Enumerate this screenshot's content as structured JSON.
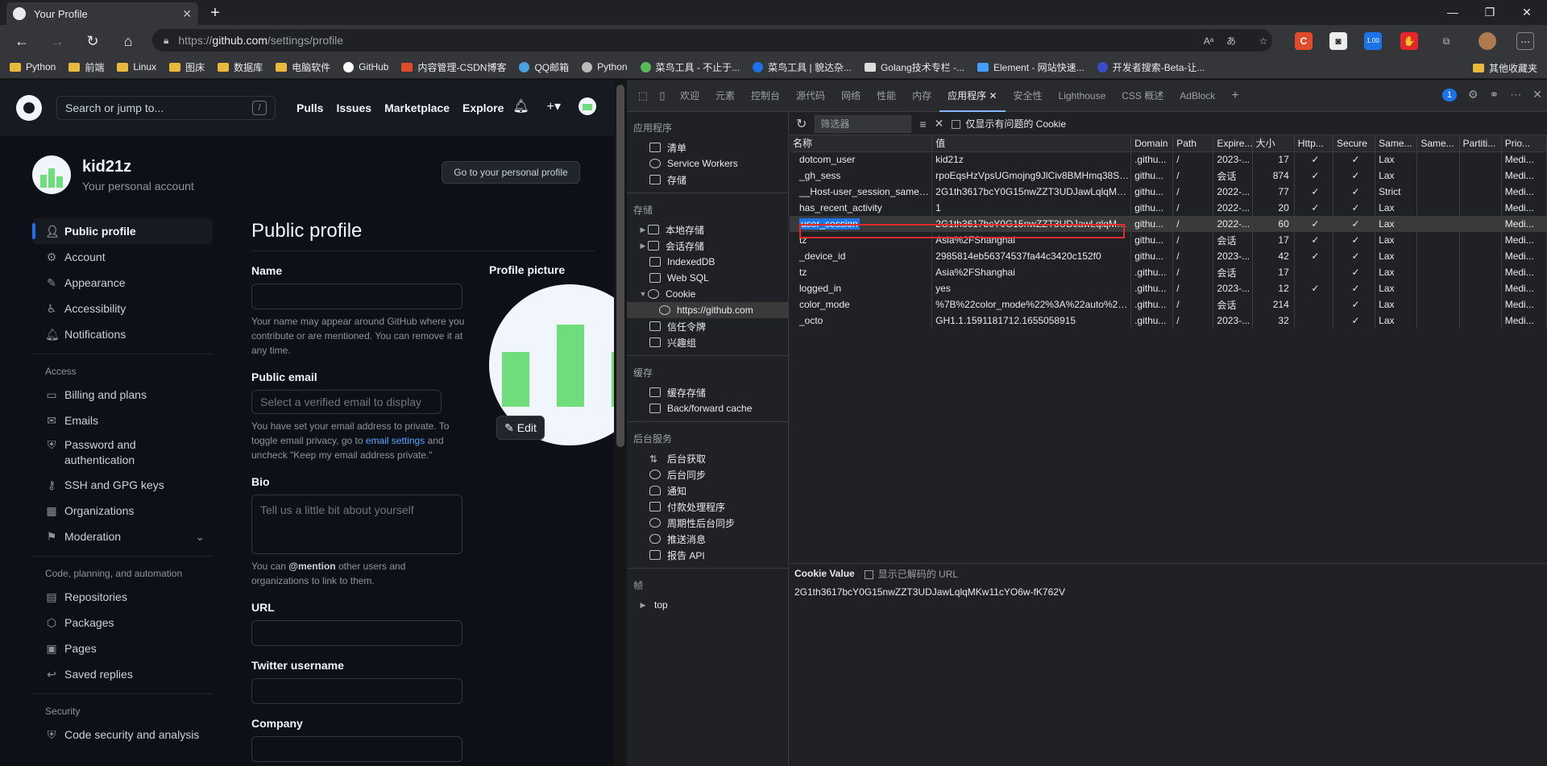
{
  "browser": {
    "tab_title": "Your Profile",
    "url_prefix": "https://",
    "url_host": "github.com",
    "url_path": "/settings/profile",
    "reader_icon": "Aᵀ",
    "zoom_badge": "1.00"
  },
  "bookmarks": [
    "Python",
    "前端",
    "Linux",
    "图床",
    "数据库",
    "电脑软件",
    "GitHub",
    "内容管理-CSDN博客",
    "QQ邮箱",
    "Python",
    "菜鸟工具 - 不止于...",
    "菜鸟工具 | 貌达杂...",
    "Golang技术专栏 -...",
    "Element - 网站快速...",
    "开发者搜索-Beta-让..."
  ],
  "bookmarks_other": "其他收藏夹",
  "github": {
    "search_placeholder": "Search or jump to...",
    "search_key": "/",
    "nav": [
      "Pulls",
      "Issues",
      "Marketplace",
      "Explore"
    ],
    "username": "kid21z",
    "account_sub": "Your personal account",
    "personal_profile_btn": "Go to your personal profile",
    "menu": {
      "public_profile": "Public profile",
      "account": "Account",
      "appearance": "Appearance",
      "accessibility": "Accessibility",
      "notifications": "Notifications",
      "access_header": "Access",
      "billing": "Billing and plans",
      "emails": "Emails",
      "password_line1": "Password and",
      "password_line2": "authentication",
      "ssh": "SSH and GPG keys",
      "organizations": "Organizations",
      "moderation": "Moderation",
      "code_header": "Code, planning, and automation",
      "repositories": "Repositories",
      "packages": "Packages",
      "pages": "Pages",
      "saved_replies": "Saved replies",
      "security_header": "Security",
      "code_security": "Code security and analysis"
    },
    "form": {
      "title": "Public profile",
      "name_label": "Name",
      "name_note": "Your name may appear around GitHub where you contribute or are mentioned. You can remove it at any time.",
      "email_label": "Public email",
      "email_placeholder": "Select a verified email to display",
      "email_note_1": "You have set your email address to private. To toggle email privacy, go to ",
      "email_note_link": "email settings",
      "email_note_2": " and uncheck \"Keep my email address private.\"",
      "bio_label": "Bio",
      "bio_placeholder": "Tell us a little bit about yourself",
      "bio_note_1": "You can ",
      "bio_note_mention": "@mention",
      "bio_note_2": " other users and organizations to link to them.",
      "url_label": "URL",
      "twitter_label": "Twitter username",
      "company_label": "Company",
      "picture_label": "Profile picture",
      "edit_btn": "Edit"
    }
  },
  "devtools": {
    "tabs": [
      "欢迎",
      "元素",
      "控制台",
      "源代码",
      "网络",
      "性能",
      "内存",
      "应用程序",
      "安全性",
      "Lighthouse",
      "CSS 概述",
      "AdBlock"
    ],
    "issues_count": "1",
    "sidebar": {
      "app_header": "应用程序",
      "manifest": "清单",
      "service_workers": "Service Workers",
      "storage": "存储",
      "storage_header": "存储",
      "local_storage": "本地存储",
      "session_storage": "会话存储",
      "indexeddb": "IndexedDB",
      "websql": "Web SQL",
      "cookie": "Cookie",
      "cookie_origin": "https://github.com",
      "trust_tokens": "信任令牌",
      "interest_groups": "兴趣组",
      "cache_header": "缓存",
      "cache_storage": "缓存存储",
      "bfcache": "Back/forward cache",
      "bg_header": "后台服务",
      "bg_fetch": "后台获取",
      "bg_sync": "后台同步",
      "notifications": "通知",
      "payment": "付款处理程序",
      "periodic_sync": "周期性后台同步",
      "push": "推送消息",
      "reporting": "报告 API",
      "frames_header": "帧",
      "top": "top"
    },
    "filter_placeholder": "筛选器",
    "only_issues": "仅显示有问题的 Cookie",
    "columns": [
      "名称",
      "值",
      "Domain",
      "Path",
      "Expire...",
      "大小",
      "Http...",
      "Secure",
      "Same...",
      "Same...",
      "Partiti...",
      "Prio..."
    ],
    "rows": [
      [
        "dotcom_user",
        "kid21z",
        ".githu...",
        "/",
        "2023-...",
        "17",
        "✓",
        "✓",
        "Lax",
        "",
        "",
        "Medi..."
      ],
      [
        "_gh_sess",
        "rpoEqsHzVpsUGmojng9JlCiv8BMHmq38SV...",
        "githu...",
        "/",
        "会话",
        "874",
        "✓",
        "✓",
        "Lax",
        "",
        "",
        "Medi..."
      ],
      [
        "__Host-user_session_same_...",
        "2G1th3617bcY0G15nwZZT3UDJawLqlqMK...",
        "githu...",
        "/",
        "2022-...",
        "77",
        "✓",
        "✓",
        "Strict",
        "",
        "",
        "Medi..."
      ],
      [
        "has_recent_activity",
        "1",
        "githu...",
        "/",
        "2022-...",
        "20",
        "✓",
        "✓",
        "Lax",
        "",
        "",
        "Medi..."
      ],
      [
        "user_session",
        "2G1th3617bcY0G15nwZZT3UDJawLqlqMK...",
        "githu...",
        "/",
        "2022-...",
        "60",
        "✓",
        "✓",
        "Lax",
        "",
        "",
        "Medi..."
      ],
      [
        "tz",
        "Asia%2FShanghai",
        "githu...",
        "/",
        "会话",
        "17",
        "✓",
        "✓",
        "Lax",
        "",
        "",
        "Medi..."
      ],
      [
        "_device_id",
        "2985814eb56374537fa44c3420c152f0",
        "githu...",
        "/",
        "2023-...",
        "42",
        "✓",
        "✓",
        "Lax",
        "",
        "",
        "Medi..."
      ],
      [
        "tz",
        "Asia%2FShanghai",
        ".githu...",
        "/",
        "会话",
        "17",
        "",
        "✓",
        "Lax",
        "",
        "",
        "Medi..."
      ],
      [
        "logged_in",
        "yes",
        ".githu...",
        "/",
        "2023-...",
        "12",
        "✓",
        "✓",
        "Lax",
        "",
        "",
        "Medi..."
      ],
      [
        "color_mode",
        "%7B%22color_mode%22%3A%22auto%22...",
        ".githu...",
        "/",
        "会话",
        "214",
        "",
        "✓",
        "Lax",
        "",
        "",
        "Medi..."
      ],
      [
        "_octo",
        "GH1.1.1591181712.1655058915",
        ".githu...",
        "/",
        "2023-...",
        "32",
        "",
        "✓",
        "Lax",
        "",
        "",
        "Medi..."
      ]
    ],
    "selected_row": 4,
    "cookie_value_label": "Cookie Value",
    "show_decoded": "显示已解码的 URL",
    "cookie_value": "2G1th3617bcY0G15nwZZT3UDJawLqlqMKw11cYO6w-fK762V"
  }
}
